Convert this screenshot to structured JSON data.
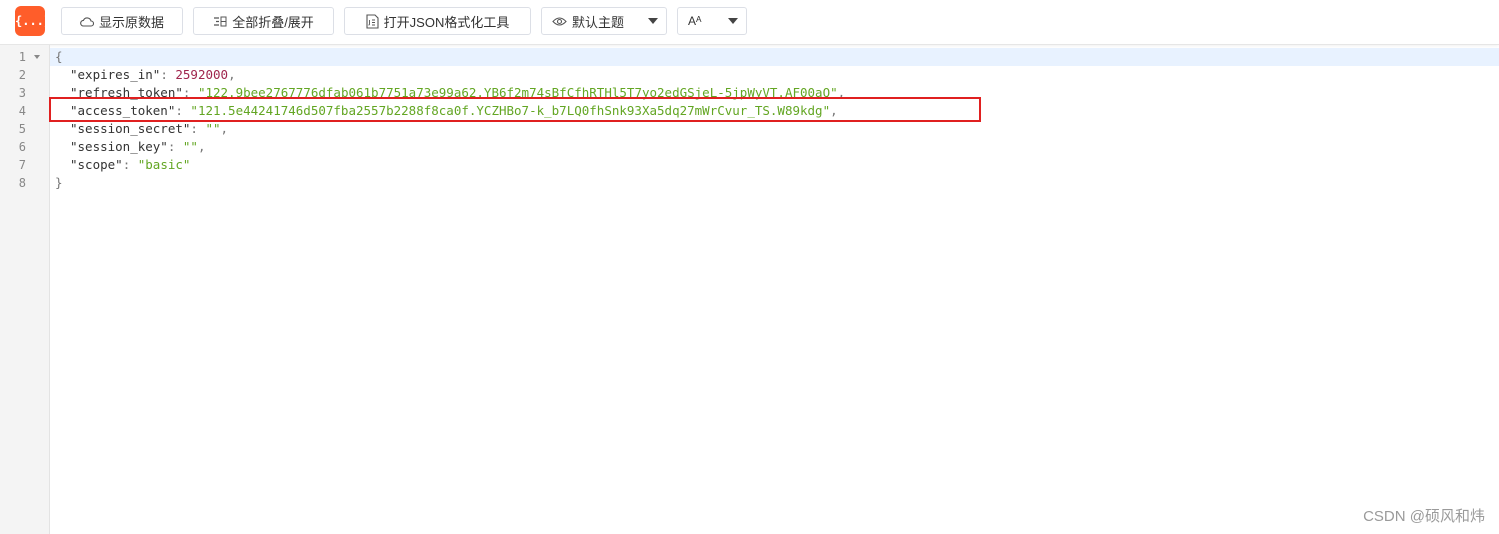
{
  "app": {
    "logo_text": "{...}",
    "brand_color": "#ff5d2a"
  },
  "toolbar": {
    "show_raw": {
      "label": "显示原数据",
      "icon": "cloud-icon"
    },
    "collapse_expand": {
      "label": "全部折叠/展开",
      "icon": "collapse-icon"
    },
    "open_formatter": {
      "label": "打开JSON格式化工具",
      "icon": "json-file-icon"
    },
    "theme_select": {
      "label": "默认主题",
      "icon": "eye-icon"
    },
    "font_select": {
      "label": "Aᴬ"
    }
  },
  "editor": {
    "line_numbers": [
      "1",
      "2",
      "3",
      "4",
      "5",
      "6",
      "7",
      "8"
    ],
    "lines": [
      {
        "open": "{"
      },
      {
        "key": "\"expires_in\"",
        "colon": ": ",
        "value": "2592000",
        "type": "number",
        "comma": ","
      },
      {
        "key": "\"refresh_token\"",
        "colon": ": ",
        "value": "\"122.9bee2767776dfab061b7751a73e99a62.YB6f2m74sBfCfhRTHl5T7yo2edGSjeL-5jpWyVT.AF00aQ\"",
        "type": "string",
        "comma": ","
      },
      {
        "key": "\"access_token\"",
        "colon": ": ",
        "value": "\"121.5e44241746d507fba2557b2288f8ca0f.YCZHBo7-k_b7LQ0fhSnk93Xa5dq27mWrCvur_TS.W89kdg\"",
        "type": "string",
        "comma": ","
      },
      {
        "key": "\"session_secret\"",
        "colon": ": ",
        "value": "\"\"",
        "type": "string",
        "comma": ","
      },
      {
        "key": "\"session_key\"",
        "colon": ": ",
        "value": "\"\"",
        "type": "string",
        "comma": ","
      },
      {
        "key": "\"scope\"",
        "colon": ": ",
        "value": "\"basic\"",
        "type": "string",
        "comma": ""
      },
      {
        "close": "}"
      }
    ],
    "colors": {
      "number": "#a0264e",
      "string": "#63a623",
      "highlight_border": "#e02020",
      "active_line": "#e8f2ff"
    }
  },
  "watermark": "CSDN @硕风和炜"
}
